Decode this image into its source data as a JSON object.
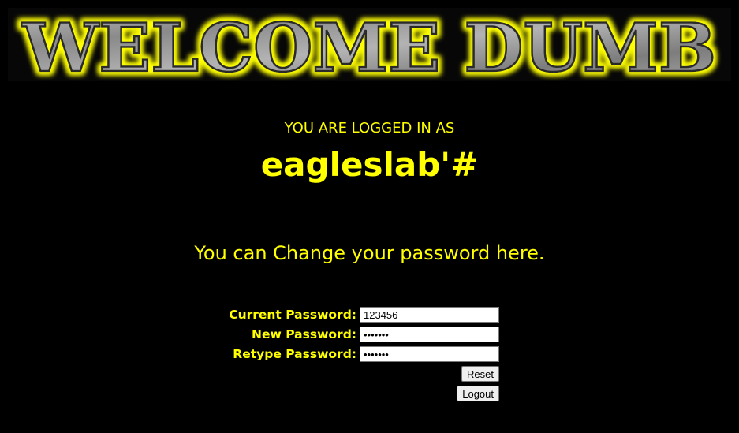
{
  "banner": {
    "text": "WELCOME DUMB",
    "glow_color": "#ffff00",
    "fill_color": "#9a9a9a"
  },
  "session": {
    "logged_in_label": "YOU ARE LOGGED IN AS",
    "username": "eagleslab'#"
  },
  "message": "You can Change your password here.",
  "form": {
    "current_password_label": "Current Password:",
    "current_password_value": "123456",
    "new_password_label": "New Password:",
    "new_password_value": "1234567",
    "retype_password_label": "Retype Password:",
    "retype_password_value": "1234567",
    "reset_label": "Reset",
    "logout_label": "Logout"
  },
  "colors": {
    "accent": "#ffff00",
    "background": "#000000"
  }
}
